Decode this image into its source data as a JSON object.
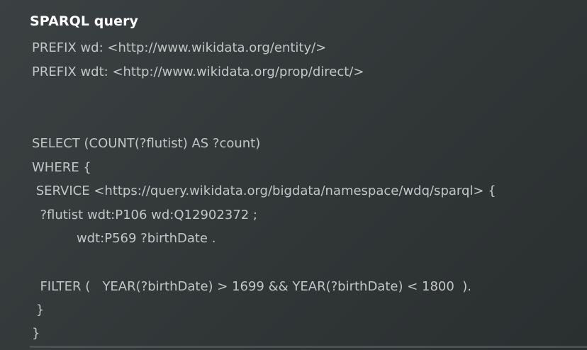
{
  "section": {
    "title": "SPARQL query"
  },
  "code": {
    "lines": [
      "PREFIX wd: <http://www.wikidata.org/entity/>",
      "PREFIX wdt: <http://www.wikidata.org/prop/direct/>",
      "SELECT (COUNT(?flutist) AS ?count)",
      "WHERE {",
      " SERVICE <https://query.wikidata.org/bigdata/namespace/wdq/sparql> {",
      "  ?flutist wdt:P106 wd:Q12902372 ;",
      "           wdt:P569 ?birthDate .",
      "  FILTER (   YEAR(?birthDate) > 1699 && YEAR(?birthDate) < 1800  ).",
      " }",
      "}"
    ]
  }
}
